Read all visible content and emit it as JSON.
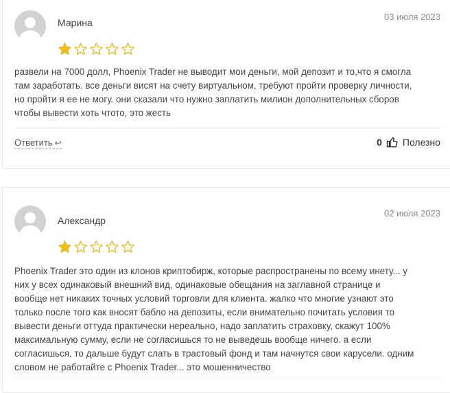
{
  "reviews": [
    {
      "name": "Марина",
      "date": "03 июля 2023",
      "rating": 1,
      "rating_max": 5,
      "text_lines": [
        "развели на 7000 долл, Phoenix Trader не выводит мои деньги, мой депозит и то,что я смогла",
        "там заработать. все деньги висят на счету виртуальном, требуют пройти проверку личности,",
        "но пройти я ее не могу. они сказали что нужно заплатить милион дополнительных сборов",
        "чтобы вывести хоть чтото, это жесть"
      ],
      "reply_label": "Ответить",
      "helpful_count": "0",
      "helpful_label": "Полезно"
    },
    {
      "name": "Александр",
      "date": "02 июля 2023",
      "rating": 1,
      "rating_max": 5,
      "text_lines": [
        "Phoenix Trader это один из клонов криптобирж, которые распространены по всему инету... у",
        "них у всех одинаковый внешний вид, одинаковые обещания на заглавной странице и",
        "вообще нет никаких точных условий торговли для клиента. жалко что многие узнают это",
        "только после того как вносят бабло на депозиты, если внимательно почитать условия то",
        "вывести деньги оттуда практически нереально, надо заплатить страховку, скажут 100%",
        "максимальную сумму, если не согласишься то не выведешь вообще ничего. а если",
        "согласишься, то дальше будут слать в трастовый фонд и там начнутся свои карусели. одним",
        "словом не работайте с Phoenix Trader... это мошенничество"
      ]
    }
  ],
  "colors": {
    "star": "#f2c012",
    "star_outline": "#e0b21a"
  },
  "icons": {
    "avatar": "user-avatar-icon",
    "reply": "reply-arrow-icon",
    "helpful": "thumbs-up-icon"
  }
}
